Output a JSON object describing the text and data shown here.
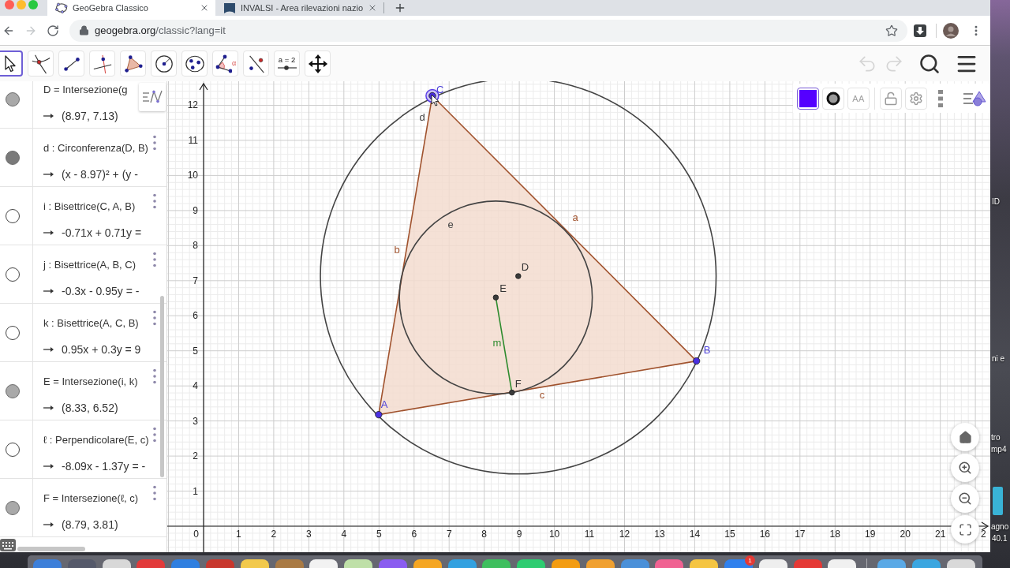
{
  "browser": {
    "tabs": [
      {
        "title": "GeoGebra Classico",
        "selected": true
      },
      {
        "title": "INVALSI - Area rilevazioni nazio",
        "selected": false
      }
    ],
    "forward_disabled": true,
    "url_host": "geogebra.org",
    "url_path": "/classic?lang=it"
  },
  "toolbar": {
    "tools": [
      {
        "kind": "move",
        "selected": true
      },
      {
        "kind": "intersect",
        "selected": false
      },
      {
        "kind": "segment",
        "selected": false
      },
      {
        "kind": "perpendicular",
        "selected": false
      },
      {
        "kind": "polygon",
        "selected": false
      },
      {
        "kind": "circle",
        "selected": false
      },
      {
        "kind": "conic",
        "selected": false
      },
      {
        "kind": "angle",
        "selected": false,
        "label": "α"
      },
      {
        "kind": "reflect",
        "selected": false
      },
      {
        "kind": "slider",
        "selected": false,
        "label": "a = 2"
      },
      {
        "kind": "move_view",
        "selected": false
      }
    ],
    "undo_disabled": true,
    "redo_disabled": true
  },
  "algebra": {
    "rows": [
      {
        "definition": "D = Intersezione(g",
        "value": "(8.97, 7.13)",
        "visible": true,
        "color": "#a9a9a9"
      },
      {
        "definition": "d : Circonferenza(D, B)",
        "value": "(x - 8.97)² + (y -",
        "visible": true,
        "color": "#7a7a7a"
      },
      {
        "definition": "i : Bisettrice(C, A, B)",
        "value": "-0.71x + 0.71y =",
        "visible": false
      },
      {
        "definition": "j : Bisettrice(A, B, C)",
        "value": "-0.3x - 0.95y = -",
        "visible": false
      },
      {
        "definition": "k : Bisettrice(A, C, B)",
        "value": "0.95x + 0.3y = 9",
        "visible": false
      },
      {
        "definition": "E = Intersezione(i, k)",
        "value": "(8.33, 6.52)",
        "visible": true,
        "color": "#a9a9a9"
      },
      {
        "definition": "ℓ : Perpendicolare(E, c)",
        "value": "-8.09x - 1.37y = -",
        "visible": false
      },
      {
        "definition": "F = Intersezione(ℓ, c)",
        "value": "(8.79, 3.81)",
        "visible": true,
        "color": "#a9a9a9"
      }
    ]
  },
  "graphics": {
    "style_bar": {
      "text_style_label": "AA"
    },
    "x_tick_labels": [
      "0",
      "1",
      "2",
      "3",
      "4",
      "5",
      "6",
      "7",
      "8",
      "9",
      "10",
      "11",
      "12",
      "13",
      "14",
      "15",
      "16",
      "17",
      "18",
      "19",
      "20",
      "21",
      "2"
    ],
    "y_tick_labels": [
      "12",
      "11",
      "10",
      "9",
      "8",
      "7",
      "6",
      "5",
      "4",
      "3",
      "2",
      "1"
    ],
    "objects": [
      {
        "label": "a",
        "kind": "segment",
        "color": "#a0522d"
      },
      {
        "label": "b",
        "kind": "segment",
        "color": "#a0522d"
      },
      {
        "label": "c",
        "kind": "segment",
        "color": "#a0522d"
      },
      {
        "label": "d",
        "kind": "circle",
        "color": "#444444"
      },
      {
        "label": "e",
        "kind": "circle",
        "color": "#444444"
      },
      {
        "label": "m",
        "kind": "segment",
        "color": "#2e8b2e"
      }
    ],
    "points": [
      {
        "label": "A",
        "kind": "free",
        "selected": false
      },
      {
        "label": "B",
        "kind": "free",
        "selected": false
      },
      {
        "label": "C",
        "kind": "free",
        "selected": true
      },
      {
        "label": "D",
        "kind": "dependent",
        "selected": false
      },
      {
        "label": "E",
        "kind": "dependent",
        "selected": false
      },
      {
        "label": "F",
        "kind": "dependent",
        "selected": false
      }
    ]
  },
  "desktop": {
    "labels": [
      "ID",
      "ni e",
      "tro",
      "mp4",
      "agno",
      "40.1"
    ]
  },
  "dock": {
    "badge": "1"
  }
}
